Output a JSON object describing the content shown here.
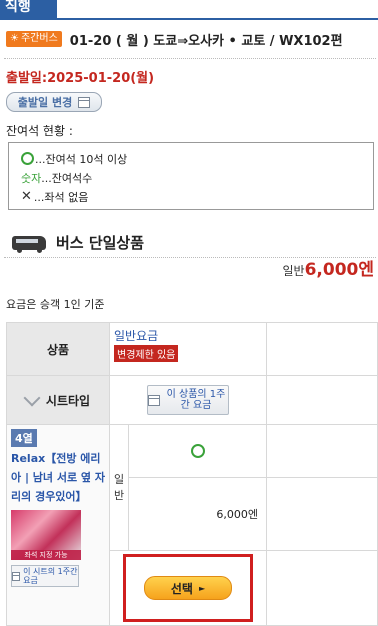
{
  "section_title": "직행",
  "route": {
    "badge": "주간버스",
    "text": "01-20 ( 월 )  도쿄⇒오사카 • 교토 / WX102편"
  },
  "departure": "출발일:2025-01-20(월)",
  "change_date_button": "출발일 변경",
  "seat_status_label": "잔여석 현황 :",
  "legend": {
    "row1": "...잔여석 10석 이상",
    "row2_num": "숫자",
    "row2": "...잔여석수",
    "row3_symbol": "✕",
    "row3": "...좌석 없음"
  },
  "product_title": "버스 단일상품",
  "price": {
    "prefix": "일반",
    "amount": "6,000엔"
  },
  "base_note": "요금은 승객 1인 기준",
  "table": {
    "header_product": "상품",
    "fare_label": "일반요금",
    "fare_limit": "변경제한 있음",
    "seat_type": "시트타입",
    "week_fare_button": "이 상품의 1주간 요금",
    "rank_badge": "4열",
    "product_name": "Relax【전방 에리아 | 남녀 서로 옆 자리의 경우있어】",
    "photo_caption": "좌석 지정 가능",
    "small_week_button": "이 시트의 1주간 요금",
    "class_label": "일반",
    "row_price": "6,000엔",
    "select_button": "선택"
  },
  "colors": {
    "accent_blue": "#2c5fa3",
    "price_red": "#c4271f",
    "available_green": "#3aa23a",
    "highlight_red": "#d01f1f"
  }
}
